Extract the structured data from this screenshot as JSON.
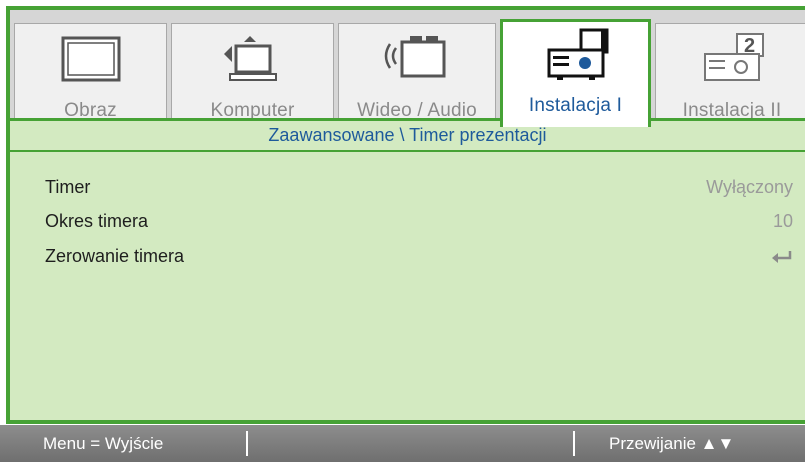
{
  "tabs": [
    {
      "label": "Obraz",
      "icon": "monitor-icon",
      "active": false
    },
    {
      "label": "Komputer",
      "icon": "computer-icon",
      "active": false
    },
    {
      "label": "Wideo / Audio",
      "icon": "video-audio-icon",
      "active": false
    },
    {
      "label": "Instalacja I",
      "icon": "projector-icon",
      "active": true
    },
    {
      "label": "Instalacja II",
      "icon": "projector-2-icon",
      "active": false
    }
  ],
  "header": {
    "title": "Zaawansowane \\ Timer prezentacji"
  },
  "settings": [
    {
      "name": "Timer",
      "value": "Wyłączony"
    },
    {
      "name": "Okres timera",
      "value": "10"
    },
    {
      "name": "Zerowanie timera",
      "value": "",
      "icon": "enter-icon"
    }
  ],
  "footer": {
    "left": "Menu = Wyjście",
    "right": "Przewijanie ▲▼"
  },
  "colors": {
    "accent_green": "#46a235",
    "panel_bg": "#d3eac1",
    "active_label": "#1e5a9b",
    "inactive_label": "#8a8a8a",
    "footer_bg": "#7e7e7e"
  }
}
